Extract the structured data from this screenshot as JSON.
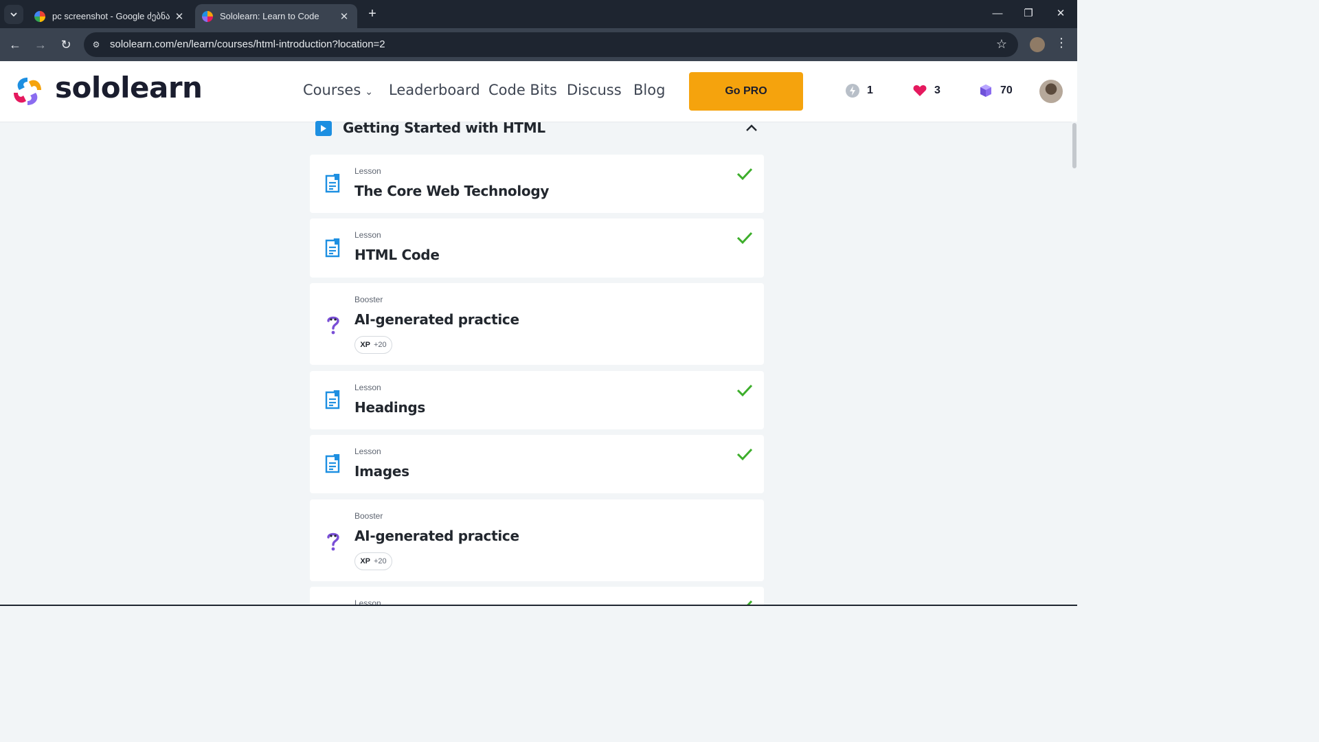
{
  "browser": {
    "tabs": [
      {
        "title": "pc screenshot - Google ძებნა",
        "favicon": "google-icon",
        "active": false
      },
      {
        "title": "Sololearn: Learn to Code",
        "favicon": "sololearn-icon",
        "active": true
      }
    ],
    "new_tab_label": "+",
    "url": "sololearn.com/en/learn/courses/html-introduction?location=2"
  },
  "header": {
    "logo_text": "sololearn",
    "nav": [
      {
        "label": "Courses",
        "has_dropdown": true
      },
      {
        "label": "Leaderboard"
      },
      {
        "label": "Code Bits"
      },
      {
        "label": "Discuss"
      },
      {
        "label": "Blog"
      }
    ],
    "go_pro_label": "Go PRO",
    "stats": {
      "streak": {
        "value": "1",
        "icon": "lightning-icon"
      },
      "hearts": {
        "value": "3",
        "icon": "heart-icon"
      },
      "gems": {
        "value": "70",
        "icon": "gem-icon"
      }
    }
  },
  "module": {
    "title": "Getting Started with HTML",
    "expanded": true
  },
  "items": [
    {
      "kind": "Lesson",
      "title": "The Core Web Technology",
      "completed": true
    },
    {
      "kind": "Lesson",
      "title": "HTML Code",
      "completed": true
    },
    {
      "kind": "Booster",
      "title": "AI-generated practice",
      "xp_label": "XP",
      "xp_value": "+20",
      "completed": false
    },
    {
      "kind": "Lesson",
      "title": "Headings",
      "completed": true
    },
    {
      "kind": "Lesson",
      "title": "Images",
      "completed": true
    },
    {
      "kind": "Booster",
      "title": "AI-generated practice",
      "xp_label": "XP",
      "xp_value": "+20",
      "completed": false
    },
    {
      "kind": "Lesson",
      "title": "",
      "completed": true
    }
  ],
  "colors": {
    "accent_blue": "#1d8fe1",
    "check_green": "#3dae2b",
    "go_pro_orange": "#f5a30d",
    "heart_pink": "#e5195e",
    "gem_purple": "#8b6cf0",
    "booster_purple": "#7a4fd6"
  }
}
